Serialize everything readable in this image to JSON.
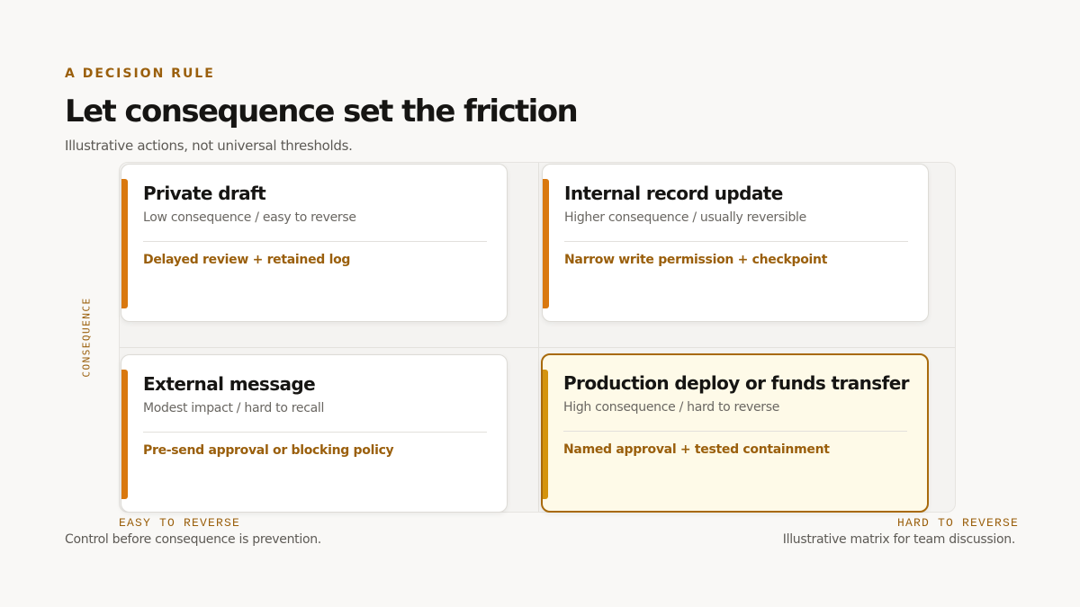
{
  "header": {
    "eyebrow": "A DECISION RULE",
    "title": "Let consequence set the friction",
    "subtitle": "Illustrative actions, not universal thresholds."
  },
  "axes": {
    "y_label": "CONSEQUENCE",
    "x_left_label": "EASY TO REVERSE",
    "x_right_label": "HARD TO REVERSE"
  },
  "quadrants": [
    {
      "title": "Private draft",
      "subtitle": "Low consequence / easy to reverse",
      "control": "Delayed review + retained log",
      "highlighted": false
    },
    {
      "title": "Internal record update",
      "subtitle": "Higher consequence / usually reversible",
      "control": "Narrow write permission + checkpoint",
      "highlighted": false
    },
    {
      "title": "External message",
      "subtitle": "Modest impact / hard to recall",
      "control": "Pre-send approval or blocking policy",
      "highlighted": false
    },
    {
      "title": "Production deploy or funds transfer",
      "subtitle": "High consequence / hard to reverse",
      "control": "Named approval + tested containment",
      "highlighted": true
    }
  ],
  "footer": {
    "left": "Control before consequence is prevention.",
    "right": "Illustrative matrix for team discussion."
  },
  "colors": {
    "accent": "#d9780f",
    "accent_highlight": "#d4940f",
    "label": "#9a5f0c",
    "highlight_bg": "#fefae8"
  }
}
